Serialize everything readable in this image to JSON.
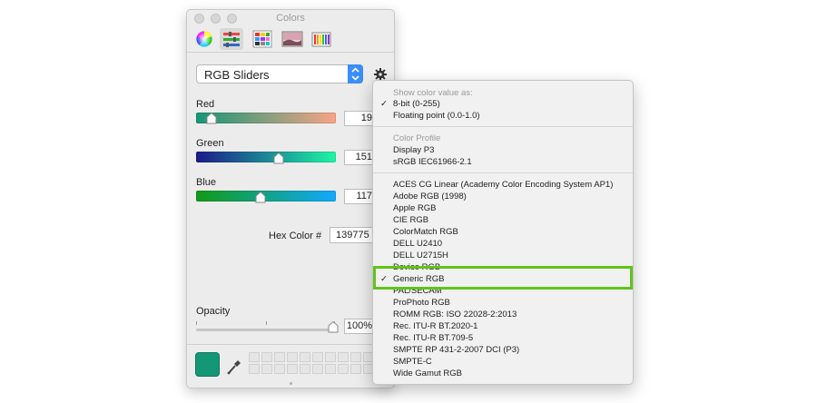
{
  "window": {
    "title": "Colors"
  },
  "toolbar": {
    "icons": [
      "color-wheel-icon",
      "sliders-icon",
      "palettes-icon",
      "image-palettes-icon",
      "pencils-icon"
    ]
  },
  "mode_popup": {
    "label": "RGB Sliders"
  },
  "sliders": {
    "red": {
      "label": "Red",
      "value": "19"
    },
    "green": {
      "label": "Green",
      "value": "151"
    },
    "blue": {
      "label": "Blue",
      "value": "117"
    }
  },
  "hex": {
    "label": "Hex Color #",
    "value": "139775"
  },
  "opacity": {
    "label": "Opacity",
    "value": "100%"
  },
  "current_color": "#139775",
  "menu": {
    "header_value": "Show color value as:",
    "value_items": [
      {
        "label": "8-bit (0-255)",
        "checked": true
      },
      {
        "label": "Floating point (0.0-1.0)",
        "checked": false
      }
    ],
    "header_profile": "Color Profile",
    "profile_items": [
      "Display P3",
      "sRGB IEC61966-2.1"
    ],
    "list_items": [
      "ACES CG Linear (Academy Color Encoding System AP1)",
      "Adobe RGB (1998)",
      "Apple RGB",
      "CIE RGB",
      "ColorMatch RGB",
      "DELL U2410",
      "DELL U2715H",
      "Device RGB",
      "Generic RGB",
      "PAL/SECAM",
      "ProPhoto RGB",
      "ROMM RGB: ISO 22028-2:2013",
      "Rec. ITU-R BT.2020-1",
      "Rec. ITU-R BT.709-5",
      "SMPTE RP 431-2-2007 DCI (P3)",
      "SMPTE-C",
      "Wide Gamut RGB"
    ],
    "checked_item": "Generic RGB",
    "checkmark": "✓"
  },
  "highlight_color": "#5ec51a"
}
